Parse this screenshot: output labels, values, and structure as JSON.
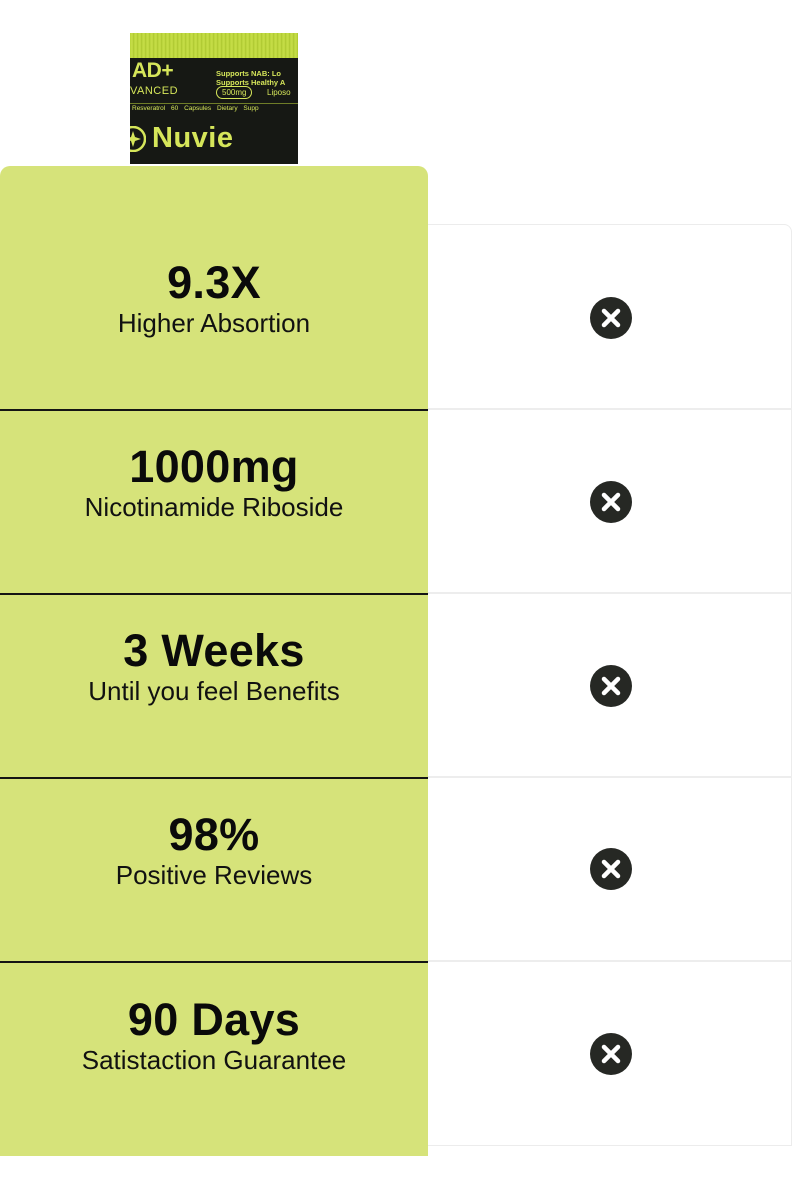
{
  "product": {
    "image_name": "nad-advanced-bottle",
    "label_lines": {
      "nad": "AD+",
      "advanced": "VANCED",
      "supports": "Supports NAB: Lo\nSupports Healthy A",
      "dose": "500mg",
      "liposomal": "Liposo",
      "small_row": "Resveratrol  60 Capsules  Dietary Supp",
      "brand": "Nuvie"
    }
  },
  "comparison": {
    "rows": [
      {
        "value": "9.3X",
        "label": "Higher Absortion",
        "competitor_icon": "x-circle-icon"
      },
      {
        "value": "1000mg",
        "label": "Nicotinamide Riboside",
        "competitor_icon": "x-circle-icon"
      },
      {
        "value": "3 Weeks",
        "label": "Until you feel Benefits",
        "competitor_icon": "x-circle-icon"
      },
      {
        "value": "98%",
        "label": "Positive Reviews",
        "competitor_icon": "x-circle-icon"
      },
      {
        "value": "90 Days",
        "label": "Satistaction Guarantee",
        "competitor_icon": "x-circle-icon"
      }
    ]
  },
  "colors": {
    "highlight": "#d6e37a",
    "icon_fill": "#262824",
    "divider_dark": "#141414",
    "divider_light": "#ededed"
  }
}
